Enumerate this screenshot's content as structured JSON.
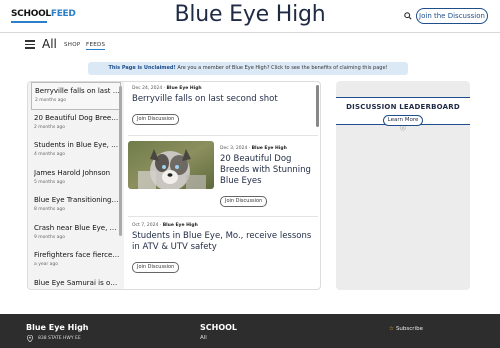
{
  "header": {
    "logo_school": "SCHOOL",
    "logo_feed": "FEED",
    "site_title": "Blue Eye High",
    "join_label": "Join the Discussion",
    "search_icon": "search-icon"
  },
  "nav": {
    "menu_icon": "hamburger-menu-icon",
    "all_label": "All",
    "shop_label": "SHOP",
    "feeds_label": "FEEDS"
  },
  "banner": {
    "strong": "This Page is Unclaimed!",
    "text": " Are you a member of Blue Eye High? Click to see the benefits of claiming this page!"
  },
  "sidebar_list": [
    {
      "title": "Berryville falls on last s...",
      "date": "2 months ago"
    },
    {
      "title": "20 Beautiful Dog Breed...",
      "date": "2 months ago"
    },
    {
      "title": "Students in Blue Eye, M...",
      "date": "4 months ago"
    },
    {
      "title": "James Harold Johnson",
      "date": "5 months ago"
    },
    {
      "title": "Blue Eye Transitioning ...",
      "date": "8 months ago"
    },
    {
      "title": "Crash near Blue Eye, M...",
      "date": "9 months ago"
    },
    {
      "title": "Firefighters face fierce ...",
      "date": "a year ago"
    },
    {
      "title": "Blue Eye Samurai is on...",
      "date": ""
    }
  ],
  "stories": [
    {
      "date": "Dec 24, 2024",
      "source": "Blue Eye High",
      "headline": "Berryville falls on last second shot",
      "button": "Join Discussion"
    },
    {
      "date": "Dec 3, 2024",
      "source": "Blue Eye High",
      "headline": "20 Beautiful Dog Breeds with Stunning Blue Eyes",
      "button": "Join Discussion"
    },
    {
      "date": "Oct 7, 2024",
      "source": "Blue Eye High",
      "headline": "Students in Blue Eye, Mo., receive lessons in ATV & UTV safety",
      "button": "Join Discussion"
    }
  ],
  "meta_sep": " · ",
  "leaderboard": {
    "title": "DISCUSSION LEADERBOARD",
    "learn_more": "Learn More"
  },
  "footer": {
    "name": "Blue Eye High",
    "address": "838 STATE HWY EE",
    "school_heading": "SCHOOL",
    "all_link": "All",
    "subscribe": "Subscribe"
  },
  "colors": {
    "accent": "#1f4e8c",
    "logo_blue": "#2b7ec7",
    "banner_bg": "#dbe9f6",
    "footer_bg": "#2d2d2d",
    "star": "#e9b824"
  }
}
